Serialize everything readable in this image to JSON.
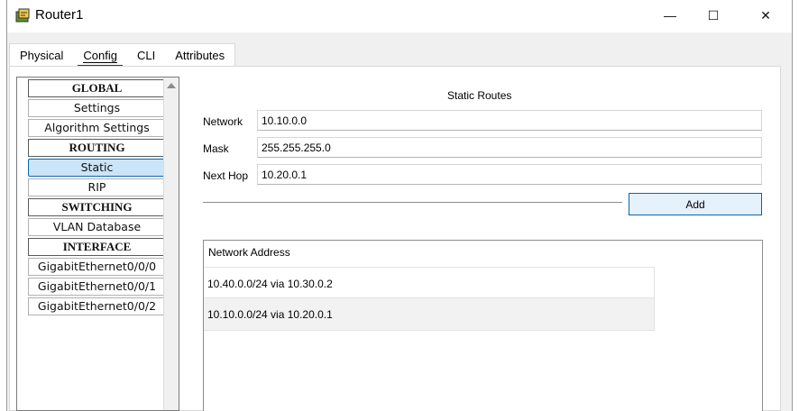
{
  "window": {
    "title": "Router1",
    "minimize_glyph": "—",
    "maximize_glyph": "☐",
    "close_glyph": "✕"
  },
  "tabs": [
    {
      "label": "Physical"
    },
    {
      "label": "Config",
      "active": true
    },
    {
      "label": "CLI"
    },
    {
      "label": "Attributes"
    }
  ],
  "sidebar": {
    "items": [
      {
        "label": "GLOBAL",
        "type": "header"
      },
      {
        "label": "Settings"
      },
      {
        "label": "Algorithm Settings"
      },
      {
        "label": "ROUTING",
        "type": "header"
      },
      {
        "label": "Static",
        "selected": true
      },
      {
        "label": "RIP"
      },
      {
        "label": "SWITCHING",
        "type": "header"
      },
      {
        "label": "VLAN Database"
      },
      {
        "label": "INTERFACE",
        "type": "header"
      },
      {
        "label": "GigabitEthernet0/0/0"
      },
      {
        "label": "GigabitEthernet0/0/1"
      },
      {
        "label": "GigabitEthernet0/0/2"
      }
    ]
  },
  "static_routes": {
    "title": "Static Routes",
    "network_label": "Network",
    "network_value": "10.10.0.0",
    "mask_label": "Mask",
    "mask_value": "255.255.255.0",
    "next_hop_label": "Next Hop",
    "next_hop_value": "10.20.0.1",
    "add_label": "Add",
    "list_header": "Network Address",
    "routes": [
      "10.40.0.0/24 via 10.30.0.2",
      "10.10.0.0/24 via 10.20.0.1"
    ]
  },
  "colors": {
    "selected_bg": "#cce4f7",
    "selected_border": "#0a64ad",
    "active_tab_underline": "#1f3f5c"
  }
}
